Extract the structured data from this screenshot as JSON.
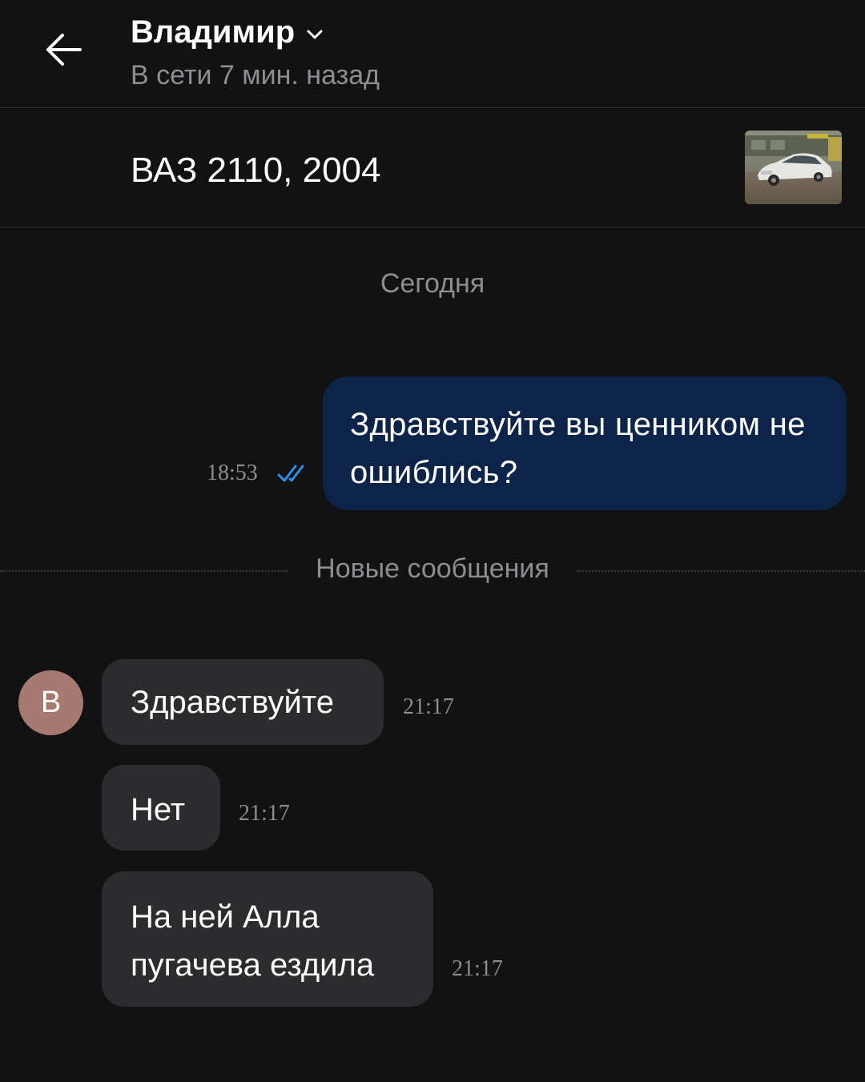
{
  "header": {
    "contact_name": "Владимир",
    "status": "В сети 7 мин. назад"
  },
  "listing": {
    "title": "ВАЗ 2110, 2004"
  },
  "date_separator": "Сегодня",
  "new_messages_label": "Новые сообщения",
  "outgoing": {
    "text": "Здравствуйте вы ценником не ошиблись?",
    "time": "18:53",
    "status": "read",
    "check_color": "#2f8de4"
  },
  "avatar": {
    "initial": "В",
    "color": "#a67a70"
  },
  "incoming": [
    {
      "text": "Здравствуйте",
      "time": "21:17"
    },
    {
      "text": "Нет",
      "time": "21:17"
    },
    {
      "text": "На ней Алла пугачева ездила",
      "time": "21:17"
    }
  ],
  "colors": {
    "background": "#121213",
    "outgoing_bubble": "#0b2447",
    "incoming_bubble": "#2c2c2e",
    "secondary_text": "#8d8d92"
  }
}
